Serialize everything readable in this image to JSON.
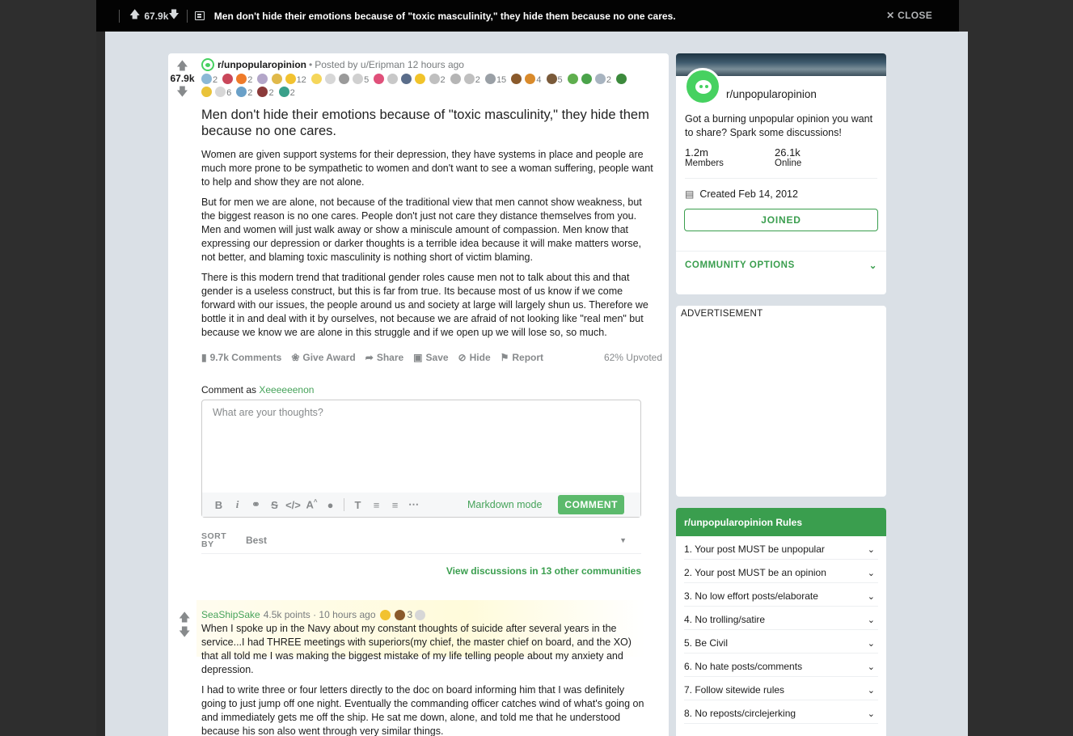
{
  "topbar": {
    "score": "67.9k",
    "title": "Men don't hide their emotions because of \"toxic masculinity,\" they hide them because no one cares.",
    "close_label": "CLOSE"
  },
  "post": {
    "score": "67.9k",
    "subreddit": "r/unpopularopinion",
    "posted_by": "Posted by u/Eripman 12 hours ago",
    "award_counts": [
      "2",
      "2",
      "12",
      "5",
      "2",
      "2",
      "15",
      "4",
      "5",
      "2",
      "6",
      "2",
      "2",
      "2"
    ],
    "title": "Men don't hide their emotions because of \"toxic masculinity,\" they hide them because no one cares.",
    "body": [
      "Women are given support systems for their depression, they have systems in place and people are much more prone to be sympathetic to women and don't want to see a woman suffering, people want to help and show they are not alone.",
      "But for men we are alone, not because of the traditional view that men cannot show weakness, but the biggest reason is no one cares. People don't just not care they distance themselves from you. Men and women will just walk away or show a miniscule amount of compassion. Men know that expressing our depression or darker thoughts is a terrible idea because it will make matters worse, not better, and blaming toxic masculinity is nothing short of victim blaming.",
      "There is this modern trend that traditional gender roles cause men not to talk about this and that gender is a useless construct, but this is far from true. Its because most of us know if we come forward with our issues, the people around us and society at large will largely shun us. Therefore we bottle it in and deal with it by ourselves, not because we are afraid of not looking like \"real men\" but because we know we are alone in this struggle and if we open up we will lose so, so much."
    ],
    "actions": {
      "comments": "9.7k Comments",
      "award": "Give Award",
      "share": "Share",
      "save": "Save",
      "hide": "Hide",
      "report": "Report",
      "upvoted": "62% Upvoted"
    }
  },
  "composer": {
    "comment_as_prefix": "Comment as",
    "username": "Xeeeeeenon",
    "placeholder": "What are your thoughts?",
    "markdown_mode": "Markdown mode",
    "comment_button": "COMMENT"
  },
  "sort": {
    "label": "SORT BY",
    "value": "Best"
  },
  "view_discussions": "View discussions in 13 other communities",
  "comment": {
    "author": "SeaShipSake",
    "meta": "4.5k points · 10 hours ago",
    "award_count": "3",
    "paragraphs": [
      "When I spoke up in the Navy about my constant thoughts of suicide after several years in the service...I had THREE meetings with superiors(my chief, the master chief on board, and the XO) that all told me I was making the biggest mistake of my life telling people about my anxiety and depression.",
      "I had to write three or four letters directly to the doc on board informing him that I was definitely going to just jump off one night. Eventually the commanding officer catches wind of what's going on and immediately gets me off the ship. He sat me down, alone, and told me that he understood because his son also went through very similar things."
    ]
  },
  "community": {
    "name": "r/unpopularopinion",
    "description": "Got a burning unpopular opinion you want to share? Spark some discussions!",
    "members_value": "1.2m",
    "members_label": "Members",
    "online_value": "26.1k",
    "online_label": "Online",
    "created": "Created Feb 14, 2012",
    "joined_label": "JOINED",
    "options_label": "COMMUNITY OPTIONS"
  },
  "advertisement_label": "ADVERTISEMENT",
  "rules": {
    "title": "r/unpopularopinion Rules",
    "items": [
      "1. Your post MUST be unpopular",
      "2. Your post MUST be an opinion",
      "3. No low effort posts/elaborate",
      "4. No trolling/satire",
      "5. Be Civil",
      "6. No hate posts/comments",
      "7. Follow sitewide rules",
      "8. No reposts/circlejerking"
    ]
  },
  "colors": {
    "accent_green": "#3a9e4e",
    "subreddit_green": "#46d160"
  }
}
